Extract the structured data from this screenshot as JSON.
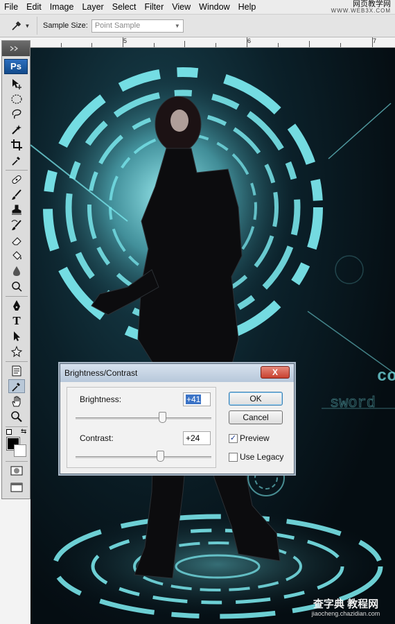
{
  "menubar": {
    "items": [
      "File",
      "Edit",
      "Image",
      "Layer",
      "Select",
      "Filter",
      "View",
      "Window",
      "Help"
    ]
  },
  "watermark_top": {
    "line1": "网页教学网",
    "line2": "WWW.WEB3X.COM"
  },
  "options": {
    "sample_size_label": "Sample Size:",
    "sample_size_value": "Point Sample"
  },
  "ruler": {
    "labels": [
      "5",
      "6",
      "7"
    ]
  },
  "toolbox": {
    "logo": "Ps",
    "tools": [
      "move-tool",
      "elliptical-marquee-tool",
      "lasso-tool",
      "magic-wand-tool",
      "crop-tool",
      "eyedropper-tool",
      "spot-healing-tool",
      "brush-tool",
      "clone-stamp-tool",
      "history-brush-tool",
      "eraser-tool",
      "paint-bucket-tool",
      "blur-tool",
      "dodge-tool",
      "pen-tool",
      "type-tool",
      "path-selection-tool",
      "custom-shape-tool",
      "notes-tool",
      "eyedropper-tool",
      "hand-tool",
      "zoom-tool"
    ],
    "type_glyph": "T",
    "active_tool": "eyedropper-tool",
    "foreground_color": "#000000",
    "background_color": "#ffffff"
  },
  "canvas_text": {
    "t1": "co",
    "t2": "sword"
  },
  "dialog": {
    "title": "Brightness/Contrast",
    "close": "X",
    "brightness_label": "Brightness:",
    "brightness_value": "+41",
    "contrast_label": "Contrast:",
    "contrast_value": "+24",
    "ok_label": "OK",
    "cancel_label": "Cancel",
    "preview_label": "Preview",
    "preview_checked": true,
    "use_legacy_label": "Use Legacy",
    "use_legacy_checked": false
  },
  "watermark_bottom": {
    "line1": "查字典 教程网",
    "line2": "jiaocheng.chazidian.com"
  },
  "colors": {
    "hud_cyan": "#7ff0f5",
    "menubar": "#ececec",
    "dialog_bg": "#efefef"
  }
}
